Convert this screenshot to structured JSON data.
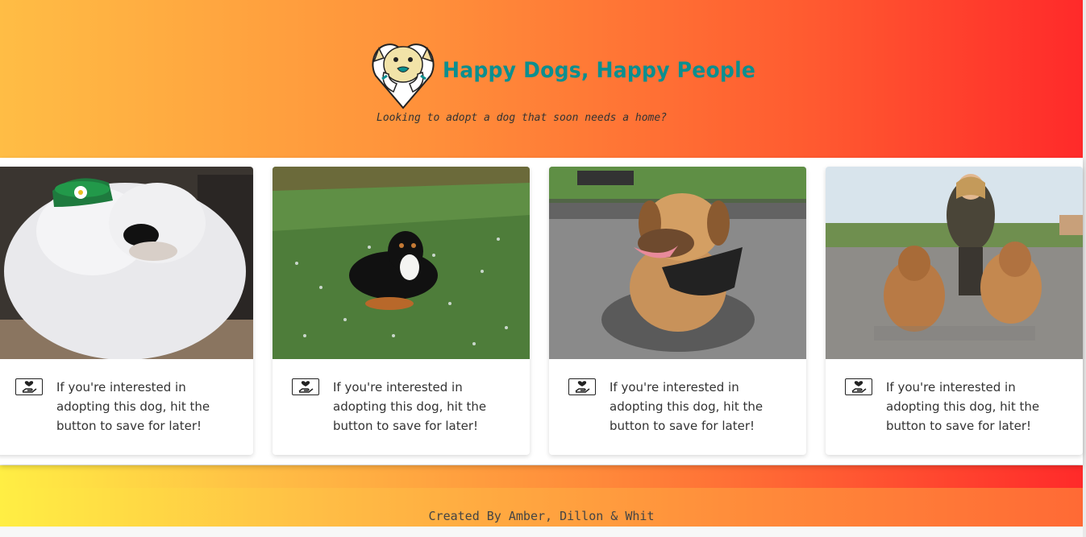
{
  "header": {
    "title": "Happy Dogs, Happy People",
    "tagline": "Looking to adopt a dog that soon needs a home?",
    "logo_icon": "dog-heart-logo-icon"
  },
  "cards": [
    {
      "text": "If you're interested in adopting this dog, hit the button to save for later!",
      "photo": "sheepdog-with-hat"
    },
    {
      "text": "If you're interested in adopting this dog, hit the button to save for later!",
      "photo": "mountain-dog-in-field"
    },
    {
      "text": "If you're interested in adopting this dog, hit the button to save for later!",
      "photo": "dog-with-bandana"
    },
    {
      "text": "If you're interested in adopting this dog, hit the button to save for later!",
      "photo": "woman-with-afghan-hounds"
    }
  ],
  "save_button_icon": "hand-heart-icon",
  "footer": {
    "text": "Created By Amber, Dillon & Whit"
  },
  "colors": {
    "title": "#0b8f8f",
    "header_gradient_start": "#ffbd45",
    "header_gradient_end": "#ff2a2a"
  }
}
